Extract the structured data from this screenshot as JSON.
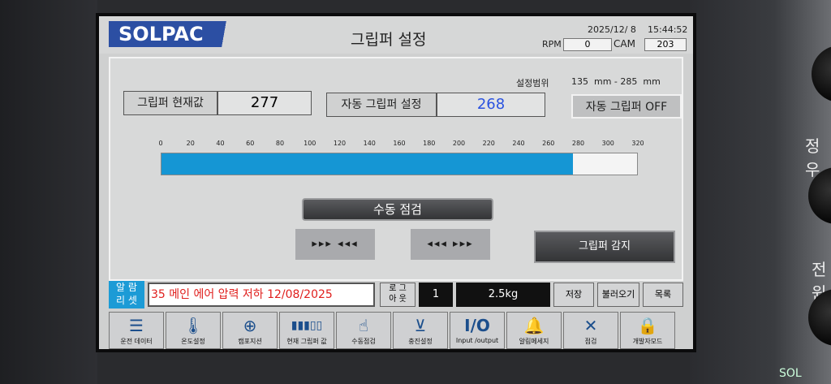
{
  "header": {
    "brand": "SOLPAC",
    "title": "그립퍼 설정",
    "date": "2025/12/ 8",
    "time": "15:44:52",
    "rpm_label": "RPM",
    "rpm_value": "0",
    "cam_label": "CAM",
    "cam_value": "203"
  },
  "main": {
    "range_label": "설정범위",
    "range_value": "135  mm - 285  mm",
    "current_label": "그립퍼 현재값",
    "current_value": "277",
    "auto_setting_label": "자동 그립퍼 설정",
    "auto_setting_value": "268",
    "auto_toggle_label": "자동 그립퍼 OFF",
    "scale": {
      "ticks": [
        "0",
        "20",
        "40",
        "60",
        "80",
        "100",
        "120",
        "140",
        "160",
        "180",
        "200",
        "220",
        "240",
        "260",
        "280",
        "300",
        "320"
      ],
      "min": 0,
      "max": 320,
      "value": 277
    },
    "manual_check_label": "수동 점검",
    "open_button_label": "▸▸▸ ◂◂◂",
    "close_button_label": "◂◂◂ ▸▸▸",
    "detect_button_label": "그립퍼 감지"
  },
  "alarm": {
    "reset_label_1": "알 람",
    "reset_label_2": "리 셋",
    "message": "35 메인 에어 압력 저하 12/08/2025",
    "log_label_1": "로 그",
    "log_label_2": "아 웃",
    "count": "1",
    "weight": "2.5kg",
    "save_label": "저장",
    "load_label": "불러오기",
    "list_label": "목록"
  },
  "bottom_nav": [
    {
      "label": "운전 데이터",
      "icon": "database-icon"
    },
    {
      "label": "온도설정",
      "icon": "thermometer-icon"
    },
    {
      "label": "캠포지션",
      "icon": "target-icon"
    },
    {
      "label": "현재 그립퍼 값",
      "icon": "gauge-bar-icon"
    },
    {
      "label": "수동점검",
      "icon": "hand-press-icon"
    },
    {
      "label": "충진설정",
      "icon": "fill-icon"
    },
    {
      "label": "Input /output",
      "icon": "io-icon"
    },
    {
      "label": "알림메세지",
      "icon": "bell-icon"
    },
    {
      "label": "점검",
      "icon": "tools-icon"
    },
    {
      "label": "개발자모드",
      "icon": "lock-icon"
    }
  ],
  "side": {
    "label_top": "정우",
    "label_bottom": "전원",
    "brand_fragment": "SOL"
  },
  "colors": {
    "bar_fill": "#1596d4",
    "logo_blue": "#2c4fa3",
    "alarm_text": "#e0201e",
    "setting_value": "#2a52e0",
    "reset_bg": "#1c9bd6"
  }
}
